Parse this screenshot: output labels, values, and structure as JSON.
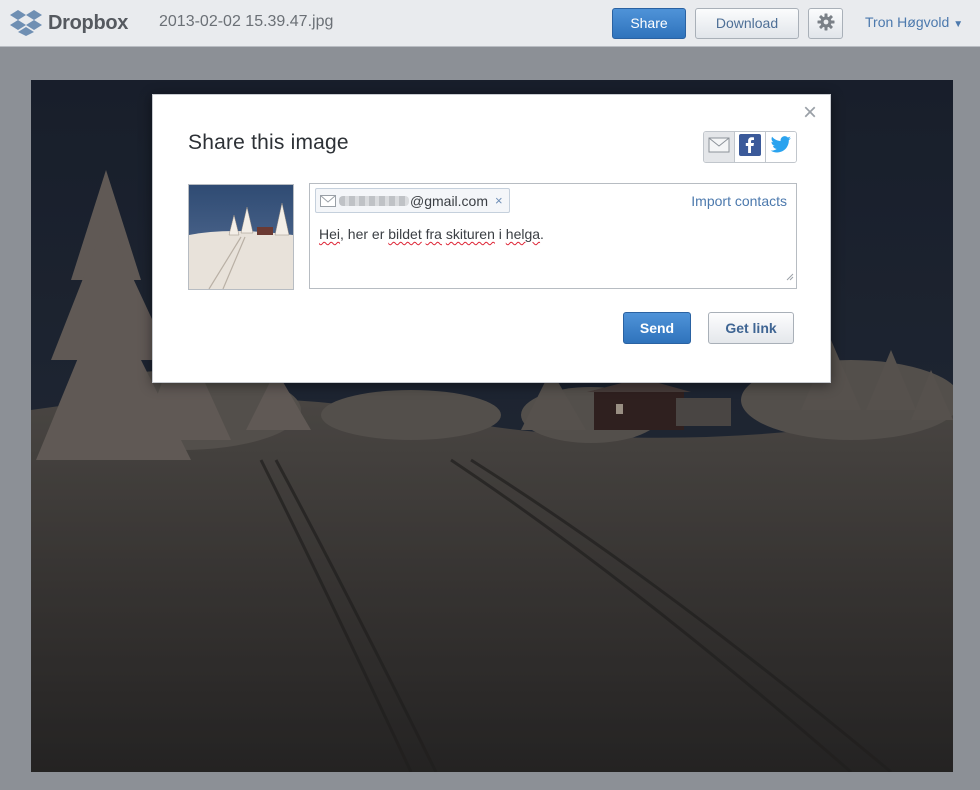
{
  "header": {
    "brand": "Dropbox",
    "filename": "2013-02-02 15.39.47.jpg",
    "share_label": "Share",
    "download_label": "Download",
    "user_name": "Tron Høgvold",
    "user_caret": "▼"
  },
  "dialog": {
    "title": "Share this image",
    "close_glyph": "×",
    "social_buttons": [
      "envelope-icon",
      "facebook-icon",
      "twitter-icon"
    ],
    "recipient_email_domain": "@gmail.com",
    "chip_remove_glyph": "×",
    "import_contacts_label": "Import contacts",
    "message_parts": [
      "Hei",
      ", her er ",
      "bildet",
      " ",
      "fra",
      " ",
      "skituren",
      " i ",
      "helga",
      "."
    ],
    "send_label": "Send",
    "get_link_label": "Get link"
  },
  "colors": {
    "primary_button": "#2f73bc",
    "link": "#4c79ad",
    "header_bg": "#e9ebee"
  }
}
